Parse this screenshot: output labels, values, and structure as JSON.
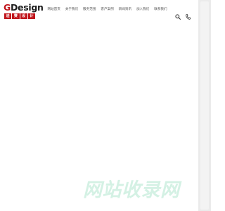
{
  "logo": {
    "title_first": "G",
    "title_rest": "Design",
    "subtitle_chars": [
      "迪",
      "赛",
      "设",
      "计"
    ]
  },
  "nav": {
    "items": [
      {
        "label": "网站首页"
      },
      {
        "label": "关于我们"
      },
      {
        "label": "服务范围"
      },
      {
        "label": "客户案例"
      },
      {
        "label": "新闻资讯"
      },
      {
        "label": "加入我们"
      },
      {
        "label": "联系我们"
      }
    ]
  },
  "icons": {
    "search": "search-icon",
    "phone": "phone-icon"
  },
  "watermark": {
    "text": "网站收录网"
  },
  "colors": {
    "brand_red": "#c0141b",
    "watermark_green": "#d4f1e4",
    "scrollbar": "#ebebeb"
  }
}
